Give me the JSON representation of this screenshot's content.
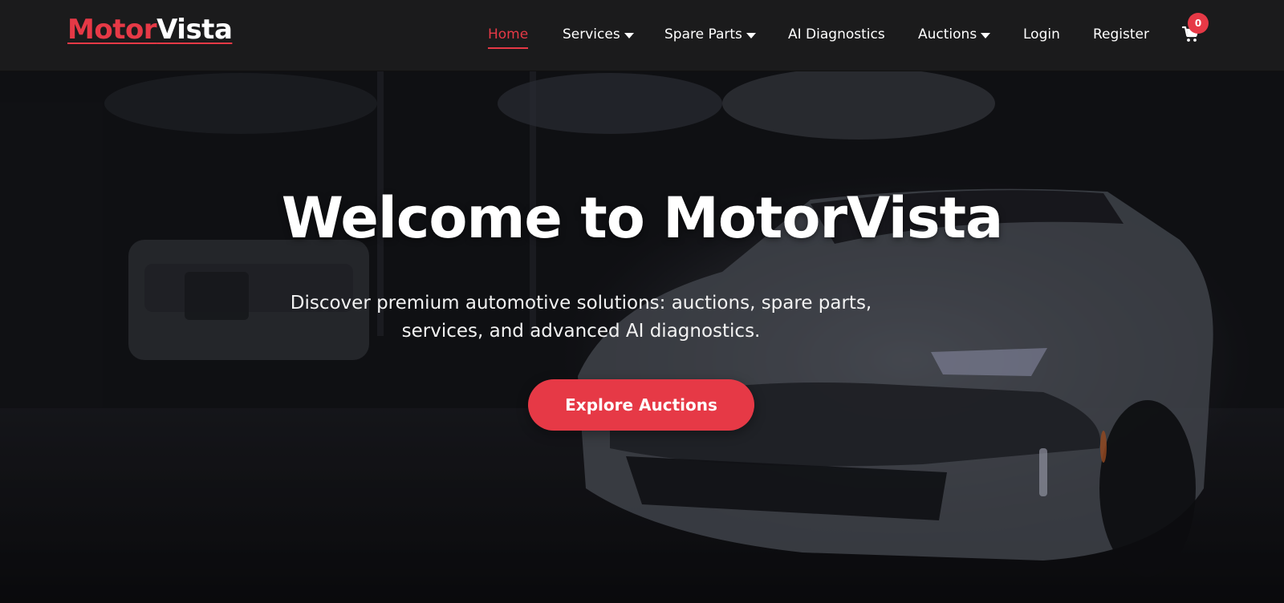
{
  "brand": {
    "part1": "Motor",
    "part2": "Vista",
    "accent_color": "#e63946"
  },
  "nav": {
    "items": [
      {
        "label": "Home",
        "active": true,
        "dropdown": false
      },
      {
        "label": "Services",
        "active": false,
        "dropdown": true
      },
      {
        "label": "Spare Parts",
        "active": false,
        "dropdown": true
      },
      {
        "label": "AI Diagnostics",
        "active": false,
        "dropdown": false
      },
      {
        "label": "Auctions",
        "active": false,
        "dropdown": true
      },
      {
        "label": "Login",
        "active": false,
        "dropdown": false
      },
      {
        "label": "Register",
        "active": false,
        "dropdown": false
      }
    ],
    "cart": {
      "icon": "cart-icon",
      "count": "0"
    }
  },
  "hero": {
    "title": "Welcome to MotorVista",
    "subtitle": "Discover premium automotive solutions: auctions, spare parts, services, and advanced AI diagnostics.",
    "cta_label": "Explore Auctions",
    "background": "dark garage with white sports car"
  },
  "colors": {
    "nav_bg": "#1b1b1c",
    "accent": "#e63946",
    "text": "#ffffff"
  }
}
